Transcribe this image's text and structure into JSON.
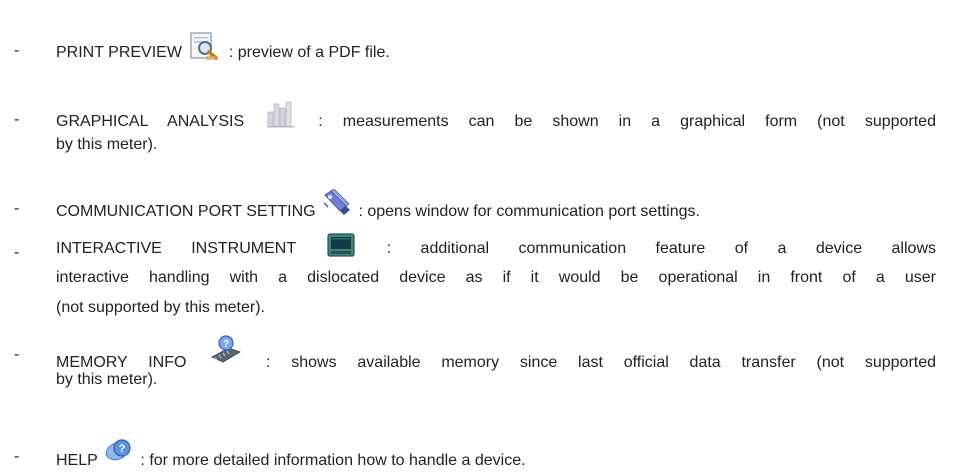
{
  "bullet": "-",
  "items": [
    {
      "name": "PRINT PREVIEW",
      "icon": "print-preview-icon",
      "lines": [
        ": preview of a PDF file."
      ]
    },
    {
      "name": "GRAPHICAL ANALYSIS",
      "icon": "bar-chart-icon",
      "lines": [
        ": measurements can be shown in a graphical form (not supported",
        "by this meter)."
      ]
    },
    {
      "name": "COMMUNICATION PORT SETTING",
      "icon": "communication-port-icon",
      "lines": [
        ": opens window for communication port settings."
      ]
    },
    {
      "name": "INTERACTIVE INSTRUMENT",
      "icon": "monitor-icon",
      "lines": [
        ": additional communication feature of a device allows",
        "interactive handling with a dislocated device as if it would be operational in front of a user",
        "(not supported by this meter)."
      ]
    },
    {
      "name": "MEMORY INFO",
      "icon": "memory-info-icon",
      "lines": [
        ": shows available memory since last official data transfer (not supported",
        "by this meter)."
      ]
    },
    {
      "name": "HELP",
      "icon": "help-icon",
      "lines": [
        ": for more detailed information how to handle a device."
      ]
    }
  ]
}
